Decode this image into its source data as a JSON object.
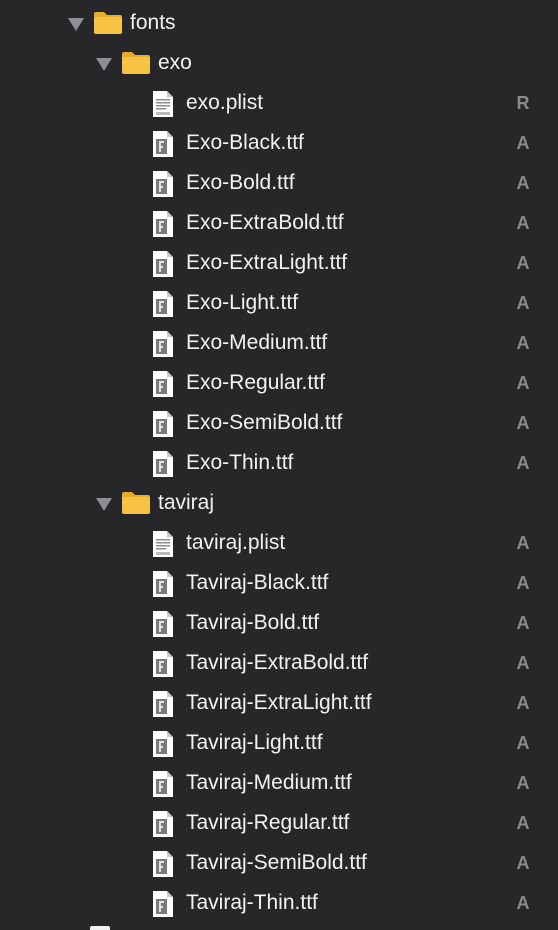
{
  "colors": {
    "background": "#272729",
    "text": "#f2f2f2",
    "status_text": "#8a8a8c",
    "disclosure": "#8e8e93",
    "folder_body": "#f6c344",
    "folder_tab": "#e8ab2a",
    "file_page": "#ffffff"
  },
  "tree": {
    "fonts": {
      "name": "fonts",
      "icon": "folder-icon",
      "expanded": true,
      "status": ""
    },
    "exo": {
      "name": "exo",
      "icon": "folder-icon",
      "expanded": true,
      "status": "",
      "files": [
        {
          "name": "exo.plist",
          "icon": "plist-file-icon",
          "status": "R"
        },
        {
          "name": "Exo-Black.ttf",
          "icon": "font-file-icon",
          "status": "A"
        },
        {
          "name": "Exo-Bold.ttf",
          "icon": "font-file-icon",
          "status": "A"
        },
        {
          "name": "Exo-ExtraBold.ttf",
          "icon": "font-file-icon",
          "status": "A"
        },
        {
          "name": "Exo-ExtraLight.ttf",
          "icon": "font-file-icon",
          "status": "A"
        },
        {
          "name": "Exo-Light.ttf",
          "icon": "font-file-icon",
          "status": "A"
        },
        {
          "name": "Exo-Medium.ttf",
          "icon": "font-file-icon",
          "status": "A"
        },
        {
          "name": "Exo-Regular.ttf",
          "icon": "font-file-icon",
          "status": "A"
        },
        {
          "name": "Exo-SemiBold.ttf",
          "icon": "font-file-icon",
          "status": "A"
        },
        {
          "name": "Exo-Thin.ttf",
          "icon": "font-file-icon",
          "status": "A"
        }
      ]
    },
    "taviraj": {
      "name": "taviraj",
      "icon": "folder-icon",
      "expanded": true,
      "status": "",
      "files": [
        {
          "name": "taviraj.plist",
          "icon": "plist-file-icon",
          "status": "A"
        },
        {
          "name": "Taviraj-Black.ttf",
          "icon": "font-file-icon",
          "status": "A"
        },
        {
          "name": "Taviraj-Bold.ttf",
          "icon": "font-file-icon",
          "status": "A"
        },
        {
          "name": "Taviraj-ExtraBold.ttf",
          "icon": "font-file-icon",
          "status": "A"
        },
        {
          "name": "Taviraj-ExtraLight.ttf",
          "icon": "font-file-icon",
          "status": "A"
        },
        {
          "name": "Taviraj-Light.ttf",
          "icon": "font-file-icon",
          "status": "A"
        },
        {
          "name": "Taviraj-Medium.ttf",
          "icon": "font-file-icon",
          "status": "A"
        },
        {
          "name": "Taviraj-Regular.ttf",
          "icon": "font-file-icon",
          "status": "A"
        },
        {
          "name": "Taviraj-SemiBold.ttf",
          "icon": "font-file-icon",
          "status": "A"
        },
        {
          "name": "Taviraj-Thin.ttf",
          "icon": "font-file-icon",
          "status": "A"
        }
      ]
    }
  }
}
